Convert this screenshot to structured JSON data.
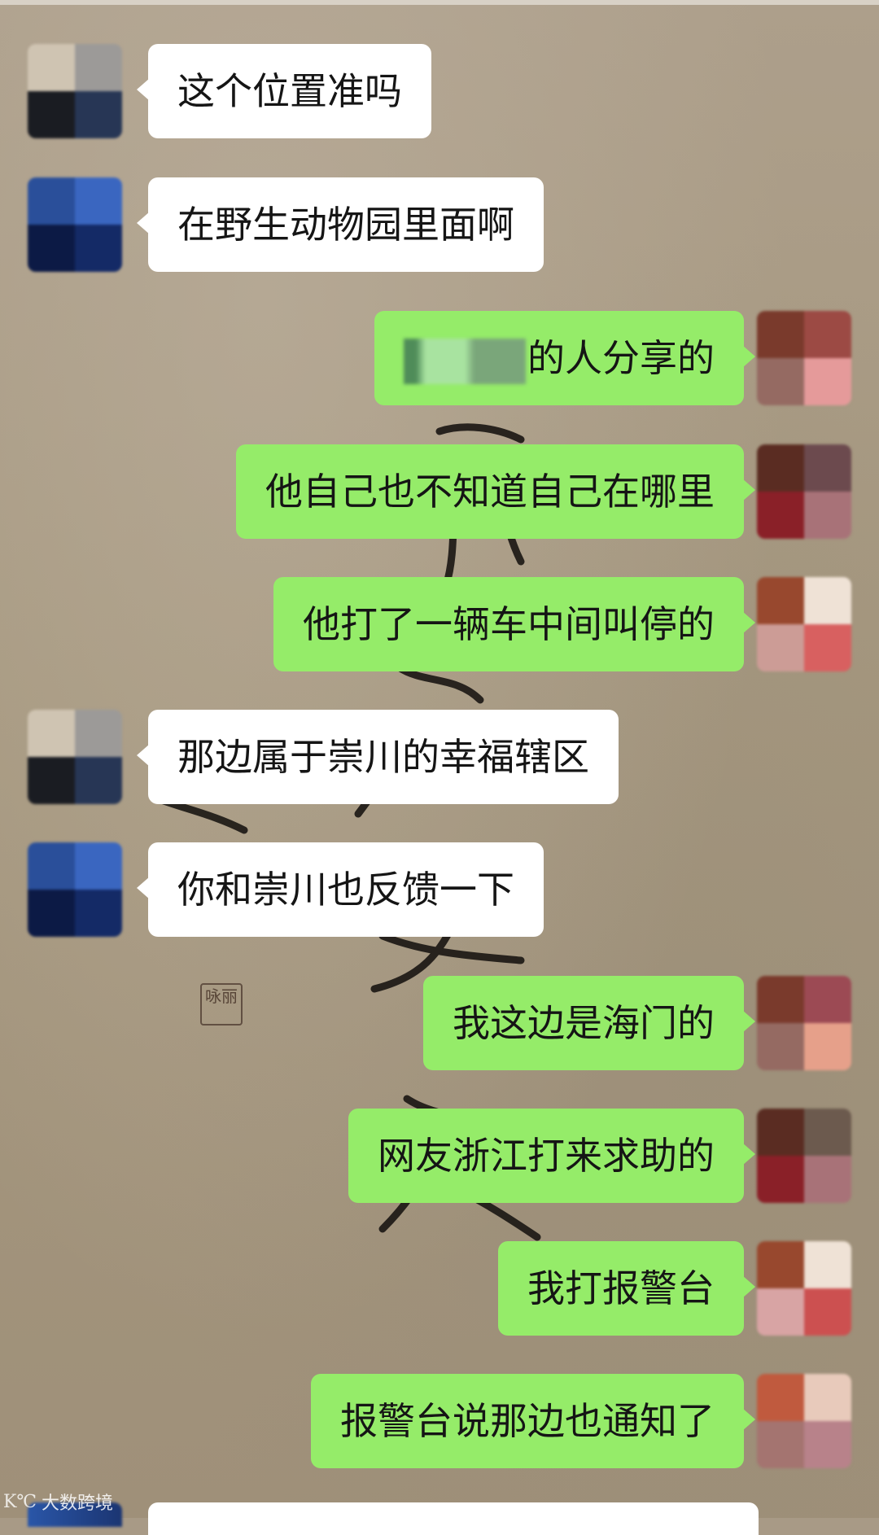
{
  "watermark": {
    "logo": "K℃",
    "text": "大数跨境"
  },
  "seal_text": "咏丽",
  "messages": [
    {
      "direction": "incoming",
      "text": "这个位置准吗",
      "avatar": [
        "#cfc4b2",
        "#9c9a98",
        "#1a1c22",
        "#273655"
      ]
    },
    {
      "direction": "incoming",
      "text": "在野生动物园里面啊",
      "avatar": [
        "#2a4f9a",
        "#3a66c0",
        "#0c1a45",
        "#142a66"
      ]
    },
    {
      "direction": "outgoing",
      "text": "的人分享的",
      "redacted_prefix": true,
      "avatar": [
        "#7a3a2c",
        "#9c4a44",
        "#956a62",
        "#e59a9a"
      ]
    },
    {
      "direction": "outgoing",
      "text": "他自己也不知道自己在哪里",
      "avatar": [
        "#5a2c22",
        "#6c4a4e",
        "#8a2028",
        "#a87278"
      ]
    },
    {
      "direction": "outgoing",
      "text": "他打了一辆车中间叫停的",
      "avatar": [
        "#98482e",
        "#efe2d6",
        "#cc9c96",
        "#d86060"
      ]
    },
    {
      "direction": "incoming",
      "text": "那边属于崇川的幸福辖区",
      "avatar": [
        "#cfc4b2",
        "#9c9a98",
        "#1a1c22",
        "#273655"
      ]
    },
    {
      "direction": "incoming",
      "text": "你和崇川也反馈一下",
      "avatar": [
        "#2a4f9a",
        "#3a66c0",
        "#0c1a45",
        "#142a66"
      ]
    },
    {
      "direction": "outgoing",
      "text": "我这边是海门的",
      "avatar": [
        "#7a3a2c",
        "#9c4a54",
        "#956a62",
        "#e6a08a"
      ]
    },
    {
      "direction": "outgoing",
      "text": "网友浙江打来求助的",
      "avatar": [
        "#5a2c22",
        "#6c5a4e",
        "#8a2028",
        "#a87278"
      ]
    },
    {
      "direction": "outgoing",
      "text": "我打报警台",
      "avatar": [
        "#98482e",
        "#efe2d6",
        "#d8a4a4",
        "#cc5050"
      ]
    },
    {
      "direction": "outgoing",
      "text": "报警台说那边也通知了",
      "avatar": [
        "#c05a3e",
        "#e8cabb",
        "#a47470",
        "#b8828a"
      ]
    }
  ]
}
